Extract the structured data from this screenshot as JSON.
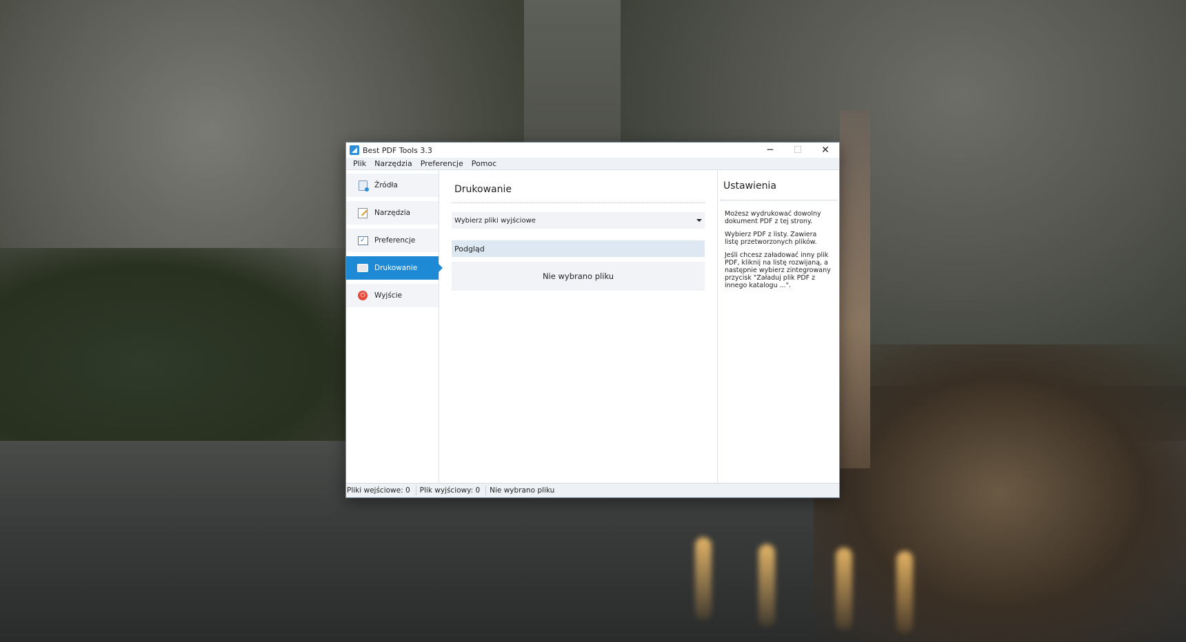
{
  "window": {
    "title": "Best PDF Tools 3.3",
    "controls": {
      "minimize": "─",
      "maximize": "☐",
      "close": "✕"
    }
  },
  "menu": [
    "Plik",
    "Narzędzia",
    "Preferencje",
    "Pomoc"
  ],
  "sidebar": {
    "items": [
      {
        "label": "Źródła",
        "icon": "source-icon"
      },
      {
        "label": "Narzędzia",
        "icon": "tools-icon"
      },
      {
        "label": "Preferencje",
        "icon": "preferences-icon"
      },
      {
        "label": "Drukowanie",
        "icon": "printer-icon",
        "active": true
      },
      {
        "label": "Wyjście",
        "icon": "exit-icon"
      }
    ]
  },
  "main": {
    "title": "Drukowanie",
    "select_value": "Wybierz pliki wyjściowe",
    "preview_label": "Podgląd",
    "preview_message": "Nie wybrano pliku"
  },
  "settings": {
    "title": "Ustawienia",
    "paragraphs": [
      "Możesz wydrukować dowolny dokument PDF z tej strony.",
      "Wybierz PDF z listy. Zawiera listę przetworzonych plików.",
      "Jeśli chcesz załadować inny plik PDF, kliknij na listę rozwijaną, a następnie wybierz zintegrowany przycisk \"Załaduj plik PDF z innego katalogu ...\"."
    ]
  },
  "statusbar": {
    "input_files": "Pliki wejściowe: 0",
    "output_file": "Plik wyjściowy: 0",
    "selected": "Nie wybrano pliku"
  },
  "colors": {
    "accent": "#1e8ad6",
    "preview_header": "#dde8f3",
    "panel_bg": "#f1f3f6"
  }
}
